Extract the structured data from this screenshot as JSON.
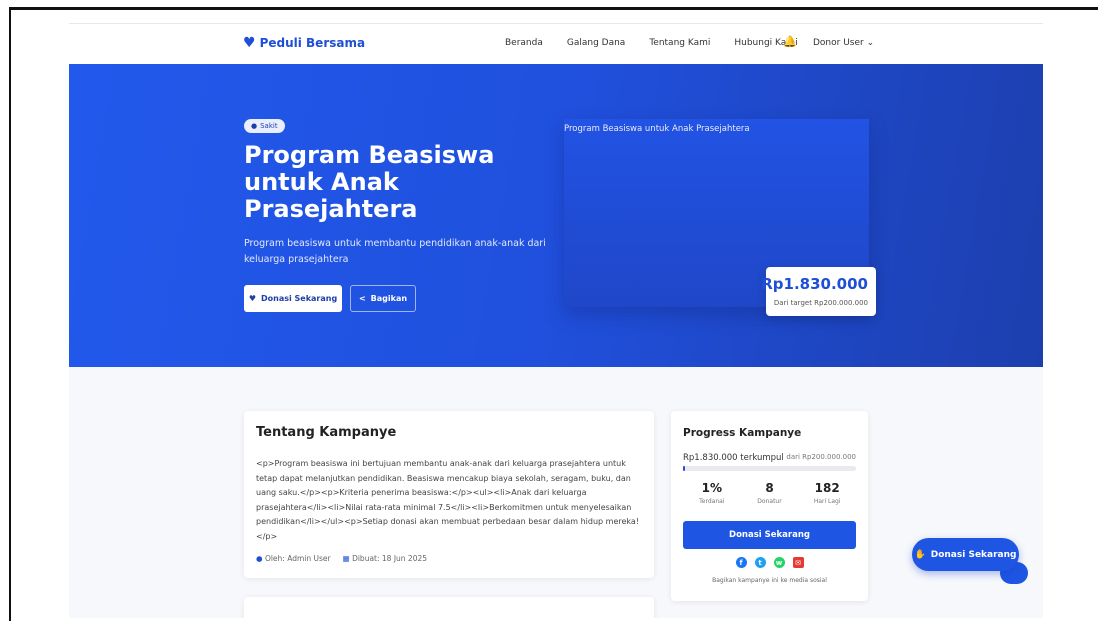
{
  "nav": {
    "brand": "Peduli Bersama",
    "links": [
      "Beranda",
      "Galang Dana",
      "Tentang Kami",
      "Hubungi Kami"
    ],
    "user": "Donor User"
  },
  "hero": {
    "badge": "Sakit",
    "title": "Program Beasiswa untuk Anak Prasejahtera",
    "description": "Program beasiswa untuk membantu pendidikan anak-anak dari keluarga prasejahtera",
    "donate_label": "Donasi Sekarang",
    "share_label": "Bagikan",
    "image_alt": "Program Beasiswa untuk Anak Prasejahtera",
    "amount": "Rp1.830.000",
    "target_text": "Dari target Rp200.000.000"
  },
  "about": {
    "heading": "Tentang Kampanye",
    "body": "<p>Program beasiswa ini bertujuan membantu anak-anak dari keluarga prasejahtera untuk tetap dapat melanjutkan pendidikan. Beasiswa mencakup biaya sekolah, seragam, buku, dan uang saku.</p><p>Kriteria penerima beasiswa:</p><ul><li>Anak dari keluarga prasejahtera</li><li>Nilai rata-rata minimal 7.5</li><li>Berkomitmen untuk menyelesaikan pendidikan</li></ul><p>Setiap donasi akan membuat perbedaan besar dalam hidup mereka!</p>",
    "author": "Oleh: Admin User",
    "created": "Dibuat: 18 Jun 2025"
  },
  "progress": {
    "heading": "Progress Kampanye",
    "collected": "Rp1.830.000 terkumpul",
    "target": "dari Rp200.000.000",
    "percent_value": 1,
    "stats": [
      {
        "value": "1%",
        "label": "Terdanai"
      },
      {
        "value": "8",
        "label": "Donatur"
      },
      {
        "value": "182",
        "label": "Hari Lagi"
      }
    ],
    "donate_label": "Donasi Sekarang",
    "share_note": "Bagikan kampanye ini ke media sosial"
  },
  "fab": {
    "label": "Donasi Sekarang"
  },
  "colors": {
    "primary": "#1e56e3",
    "hero_start": "#2259ec",
    "hero_end": "#1d3fae"
  }
}
